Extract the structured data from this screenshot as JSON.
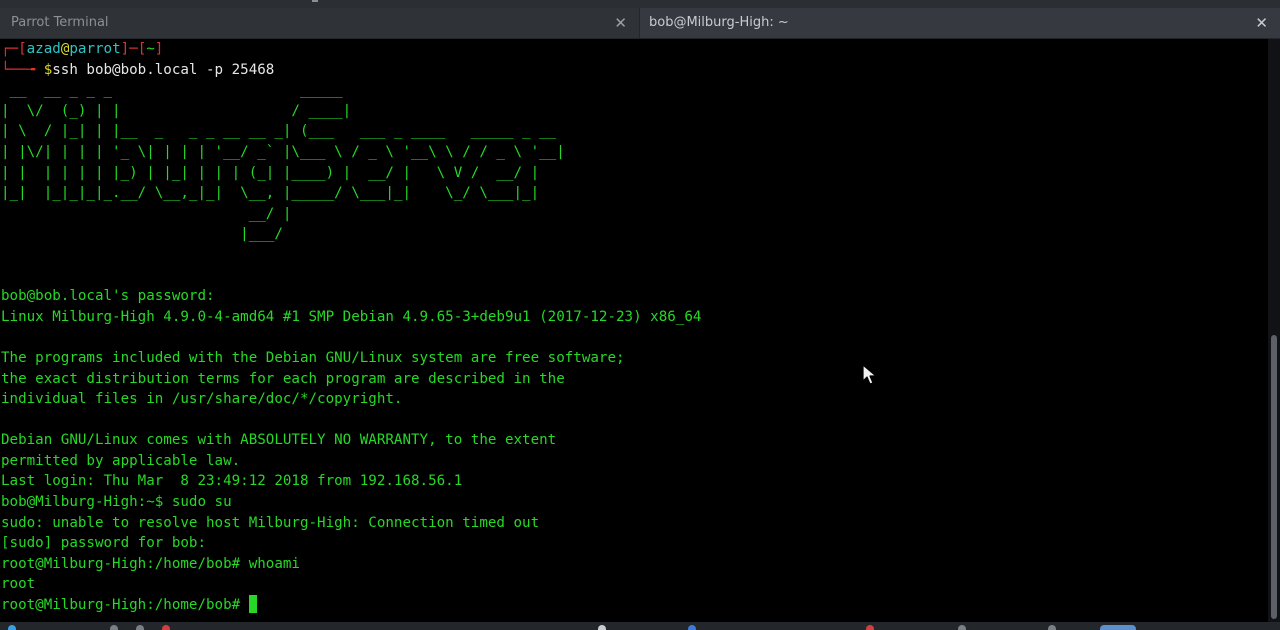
{
  "tabs": [
    {
      "title": "Parrot Terminal",
      "close": "✕",
      "active": false
    },
    {
      "title": "bob@Milburg-High: ~",
      "close": "✕",
      "active": true
    }
  ],
  "prompt": {
    "corner_top": "┌─",
    "open_bracket": "[",
    "user": "azad",
    "at": "@",
    "host": "parrot",
    "close_bracket": "]",
    "sep": "─",
    "open_dir": "[",
    "dir": "~",
    "close_dir": "]",
    "corner_bottom": "└──╼ ",
    "dollar": "$",
    "command": "ssh bob@bob.local -p 25468"
  },
  "banner": [
    " __  __ _ _ _                      _____",
    "|  \\/  (_) | |                    / ____|",
    "| \\  / |_| | |__  _   _ _ __ __ _| (___   ___ _ ____   _____ _ __",
    "| |\\/| | | | '_ \\| | | | '__/ _` |\\___ \\ / _ \\ '__\\ \\ / / _ \\ '__|",
    "| |  | | | | |_) | |_| | | | (_| |____) |  __/ |   \\ V /  __/ |",
    "|_|  |_|_|_|_.__/ \\__,_|_|  \\__, |_____/ \\___|_|    \\_/ \\___|_|",
    "                             __/ |",
    "                            |___/"
  ],
  "session": [
    "bob@bob.local's password:",
    "Linux Milburg-High 4.9.0-4-amd64 #1 SMP Debian 4.9.65-3+deb9u1 (2017-12-23) x86_64",
    "",
    "The programs included with the Debian GNU/Linux system are free software;",
    "the exact distribution terms for each program are described in the",
    "individual files in /usr/share/doc/*/copyright.",
    "",
    "Debian GNU/Linux comes with ABSOLUTELY NO WARRANTY, to the extent",
    "permitted by applicable law.",
    "Last login: Thu Mar  8 23:49:12 2018 from 192.168.56.1",
    "bob@Milburg-High:~$ sudo su",
    "sudo: unable to resolve host Milburg-High: Connection timed out",
    "[sudo] password for bob:",
    "root@Milburg-High:/home/bob# whoami",
    "root"
  ],
  "final_prompt": "root@Milburg-High:/home/bob# ",
  "colors": {
    "terminal_text": "#27d827",
    "prompt_red": "#e03131",
    "prompt_cyan": "#2bc4c4",
    "prompt_yellow": "#d8d82a",
    "background": "#000000",
    "tab_bar": "#2f3237"
  },
  "icons": {
    "tab_close": "close-icon",
    "pointer": "mouse-pointer-icon"
  }
}
